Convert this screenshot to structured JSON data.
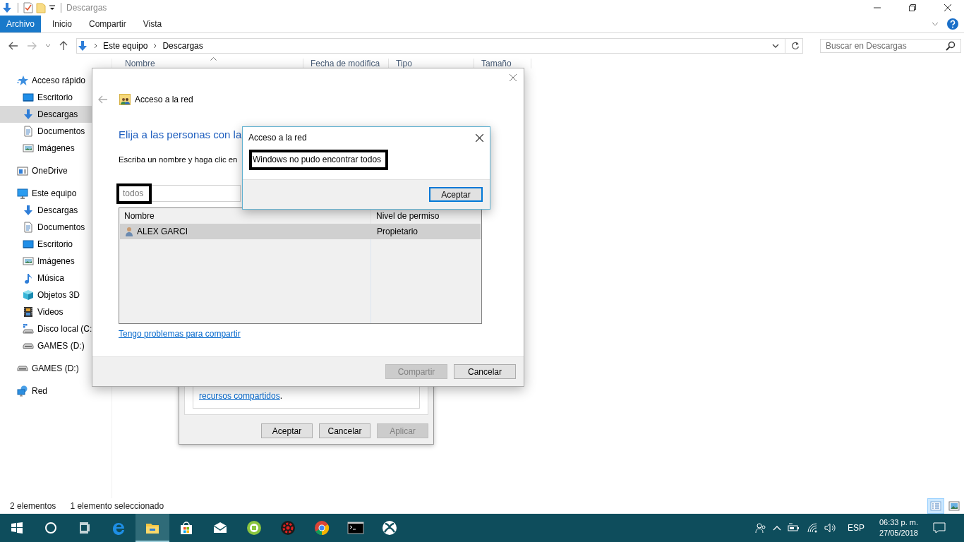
{
  "window": {
    "title": "Descargas"
  },
  "ribbon": {
    "tabs": [
      {
        "label": "Archivo",
        "kind": "file"
      },
      {
        "label": "Inicio",
        "kind": "tab"
      },
      {
        "label": "Compartir",
        "kind": "tab"
      },
      {
        "label": "Vista",
        "kind": "tab"
      }
    ]
  },
  "address": {
    "path": [
      "Este equipo",
      "Descargas"
    ]
  },
  "search": {
    "placeholder": "Buscar en Descargas"
  },
  "columns": [
    {
      "label": "Nombre",
      "sorted": true
    },
    {
      "label": "Fecha de modifica",
      "sorted": false
    },
    {
      "label": "Tipo",
      "sorted": false
    },
    {
      "label": "Tamaño",
      "sorted": false
    }
  ],
  "sidebar": {
    "items": [
      {
        "label": "Acceso rápido",
        "kind": "star",
        "selected": false,
        "children": [
          {
            "label": "Escritorio",
            "kind": "desktop",
            "selected": false
          },
          {
            "label": "Descargas",
            "kind": "download",
            "selected": true
          },
          {
            "label": "Documentos",
            "kind": "document",
            "selected": false
          },
          {
            "label": "Imágenes",
            "kind": "images",
            "selected": false
          }
        ]
      },
      {
        "label": "OneDrive",
        "kind": "cloud",
        "selected": false
      },
      {
        "label": "Este equipo",
        "kind": "computer",
        "selected": false,
        "children": [
          {
            "label": "Descargas",
            "kind": "download",
            "selected": false
          },
          {
            "label": "Documentos",
            "kind": "document",
            "selected": false
          },
          {
            "label": "Escritorio",
            "kind": "desktop",
            "selected": false
          },
          {
            "label": "Imágenes",
            "kind": "images",
            "selected": false
          },
          {
            "label": "Música",
            "kind": "music",
            "selected": false
          },
          {
            "label": "Objetos 3D",
            "kind": "cube",
            "selected": false
          },
          {
            "label": "Videos",
            "kind": "video",
            "selected": false
          },
          {
            "label": "Disco local (C:",
            "kind": "disk",
            "selected": false
          },
          {
            "label": "GAMES (D:)",
            "kind": "drive",
            "selected": false
          }
        ]
      },
      {
        "label": "GAMES (D:)",
        "kind": "drive",
        "selected": false
      },
      {
        "label": "Red",
        "kind": "network",
        "selected": false
      }
    ]
  },
  "status_bar": {
    "items": [
      "2 elementos",
      "1 elemento seleccionado"
    ],
    "views": [
      {
        "kind": "details",
        "selected": true
      },
      {
        "kind": "tiles",
        "selected": false
      }
    ]
  },
  "properties_dialog": {
    "link": "recursos compartidos",
    "suffix": ".",
    "buttons": [
      {
        "label": "Aceptar",
        "disabled": false
      },
      {
        "label": "Cancelar",
        "disabled": false
      },
      {
        "label": "Aplicar",
        "disabled": true
      }
    ]
  },
  "share_dialog": {
    "title": "Acceso a la red",
    "heading": "Elija a las personas con la",
    "instruction": "Escriba un nombre y haga clic en",
    "input": {
      "value": "todos",
      "annotated": true
    },
    "table": {
      "columns": [
        "Nombre",
        "Nivel de permiso"
      ],
      "rows": [
        {
          "cells": [
            "ALEX GARCI",
            "Propietario"
          ],
          "selected": true
        }
      ]
    },
    "help_link": "Tengo problemas para compartir",
    "buttons": [
      {
        "label": "Compartir",
        "disabled": true
      },
      {
        "label": "Cancelar",
        "disabled": false
      }
    ]
  },
  "error_dialog": {
    "title": "Acceso a la red",
    "message": "Windows no pudo encontrar todos",
    "annotated": true,
    "buttons": [
      {
        "label": "Aceptar",
        "default": true
      }
    ]
  },
  "taskbar": {
    "apps": [
      {
        "kind": "start",
        "selected": false
      },
      {
        "kind": "search",
        "selected": false
      },
      {
        "kind": "taskview",
        "selected": false
      },
      {
        "kind": "browser",
        "selected": false
      },
      {
        "kind": "explorer",
        "selected": true
      },
      {
        "kind": "store",
        "selected": false
      },
      {
        "kind": "mail",
        "selected": false
      },
      {
        "kind": "greenapp",
        "selected": false
      },
      {
        "kind": "redapp",
        "selected": false
      },
      {
        "kind": "chrome",
        "selected": false
      },
      {
        "kind": "terminal",
        "selected": false
      },
      {
        "kind": "xbox",
        "selected": false
      }
    ],
    "language": "ESP",
    "time": "06:33 p. m.",
    "date": "27/05/2018"
  }
}
